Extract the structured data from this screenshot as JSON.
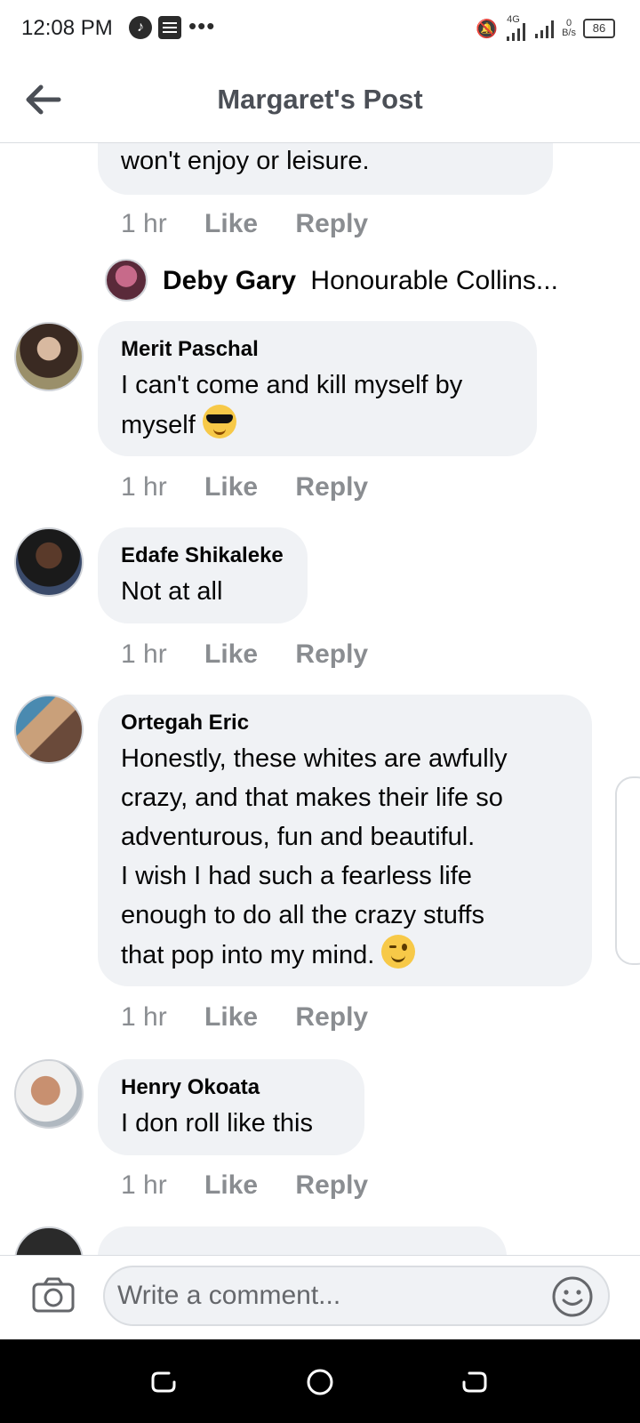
{
  "status_bar": {
    "time": "12:08 PM",
    "network_type": "4G",
    "speed_value": "0",
    "speed_unit": "B/s",
    "battery": "86"
  },
  "header": {
    "title": "Margaret's Post"
  },
  "comments": [
    {
      "text": "won't enjoy or leisure.",
      "time": "1 hr",
      "like": "Like",
      "reply": "Reply"
    },
    {
      "reply_preview": {
        "name": "Deby Gary",
        "snippet": "Honourable Collins..."
      }
    },
    {
      "name": "Merit Paschal",
      "text": "I can't come and kill myself by myself",
      "emoji": "sunglasses-face",
      "time": "1 hr",
      "like": "Like",
      "reply": "Reply"
    },
    {
      "name": "Edafe Shikaleke",
      "text": "Not at all",
      "time": "1 hr",
      "like": "Like",
      "reply": "Reply"
    },
    {
      "name": "Ortegah Eric",
      "lines": [
        "Honestly, these whites are awfully",
        "crazy, and that makes their life so",
        "adventurous, fun and beautiful.",
        "I wish I had such a fearless life",
        "enough to do all the crazy stuffs",
        "that pop into my mind."
      ],
      "emoji": "winking-face",
      "time": "1 hr",
      "like": "Like",
      "reply": "Reply"
    },
    {
      "name": "Henry Okoata",
      "text": "I don roll like this",
      "time": "1 hr",
      "like": "Like",
      "reply": "Reply"
    }
  ],
  "composer": {
    "placeholder": "Write a comment..."
  },
  "colors": {
    "bubble": "#f0f2f5",
    "action": "#8a8d91",
    "title": "#4b4f56"
  }
}
